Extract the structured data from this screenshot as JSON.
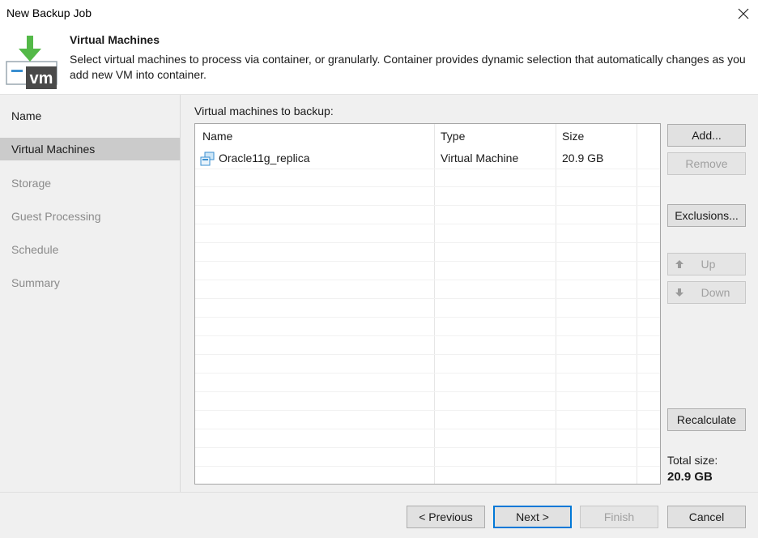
{
  "window": {
    "title": "New Backup Job",
    "close_icon": "close-icon"
  },
  "header": {
    "title": "Virtual Machines",
    "description": "Select virtual machines to process via container, or granularly. Container provides dynamic selection that automatically changes as you add new VM into container.",
    "icon": "vm-download-icon",
    "icon_text": "vm"
  },
  "sidebar": {
    "items": [
      {
        "label": "Name",
        "state": "done"
      },
      {
        "label": "Virtual Machines",
        "state": "active"
      },
      {
        "label": "Storage",
        "state": "pending"
      },
      {
        "label": "Guest Processing",
        "state": "pending"
      },
      {
        "label": "Schedule",
        "state": "pending"
      },
      {
        "label": "Summary",
        "state": "pending"
      }
    ]
  },
  "main": {
    "list_label": "Virtual machines to backup:",
    "columns": [
      "Name",
      "Type",
      "Size"
    ],
    "rows": [
      {
        "name": "Oracle11g_replica",
        "type": "Virtual Machine",
        "size": "20.9 GB",
        "icon": "vm-icon"
      }
    ]
  },
  "side_buttons": {
    "add": "Add...",
    "remove": "Remove",
    "exclusions": "Exclusions...",
    "up": "Up",
    "down": "Down",
    "recalculate": "Recalculate"
  },
  "total": {
    "label": "Total size:",
    "value": "20.9 GB"
  },
  "footer": {
    "previous": "< Previous",
    "next": "Next >",
    "finish": "Finish",
    "cancel": "Cancel"
  },
  "colors": {
    "accent": "#0078d7",
    "brand_green": "#54b948",
    "active_step": "#cbcbcb"
  }
}
